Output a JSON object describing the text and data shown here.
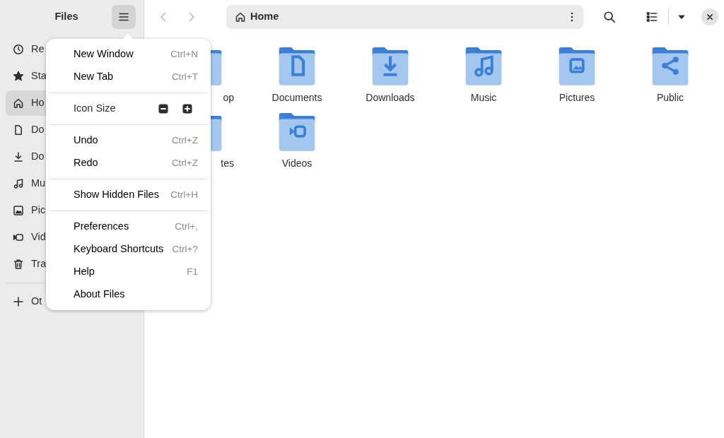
{
  "sidebar": {
    "title": "Files",
    "items": [
      {
        "label": "Re",
        "selected": false
      },
      {
        "label": "Sta",
        "selected": false
      },
      {
        "label": "Ho",
        "selected": true
      },
      {
        "label": "Do",
        "selected": false
      },
      {
        "label": "Do",
        "selected": false
      },
      {
        "label": "Mu",
        "selected": false
      },
      {
        "label": "Pic",
        "selected": false
      },
      {
        "label": "Vid",
        "selected": false
      },
      {
        "label": "Tra",
        "selected": false
      }
    ],
    "other": {
      "label": "Ot"
    }
  },
  "toolbar": {
    "path": "Home",
    "back_disabled": true,
    "forward_disabled": true
  },
  "folders": [
    {
      "label": "op",
      "cut": true
    },
    {
      "label": "Documents",
      "cut": false
    },
    {
      "label": "Downloads",
      "cut": false
    },
    {
      "label": "Music",
      "cut": false
    },
    {
      "label": "Pictures",
      "cut": false
    },
    {
      "label": "Public",
      "cut": false
    },
    {
      "label": "tes",
      "cut": true
    },
    {
      "label": "Videos",
      "cut": false
    }
  ],
  "menu": {
    "sections": [
      [
        {
          "label": "New Window",
          "shortcut": "Ctrl+N"
        },
        {
          "label": "New Tab",
          "shortcut": "Ctrl+T"
        }
      ],
      [
        {
          "label": "Icon Size",
          "kind": "zoom"
        }
      ],
      [
        {
          "label": "Undo",
          "shortcut": "Ctrl+Z"
        },
        {
          "label": "Redo",
          "shortcut": "Ctrl+Z"
        }
      ],
      [
        {
          "label": "Show Hidden Files",
          "shortcut": "Ctrl+H"
        }
      ],
      [
        {
          "label": "Preferences",
          "shortcut": "Ctrl+,"
        },
        {
          "label": "Keyboard Shortcuts",
          "shortcut": "Ctrl+?"
        },
        {
          "label": "Help",
          "shortcut": "F1"
        },
        {
          "label": "About Files"
        }
      ]
    ]
  }
}
